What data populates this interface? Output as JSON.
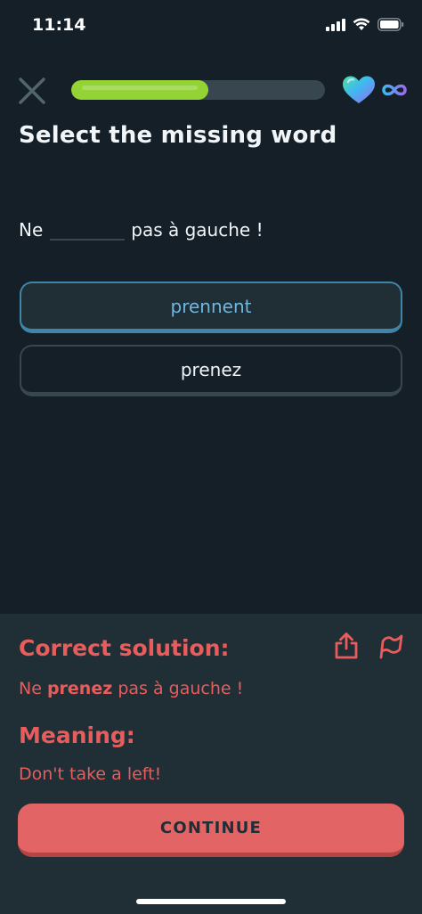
{
  "status_bar": {
    "time": "11:14",
    "icons": [
      "cellular-signal-icon",
      "wifi-icon",
      "battery-icon"
    ]
  },
  "header": {
    "close_icon": "close-icon",
    "progress": 0.54,
    "hearts_icon": "heart-icon",
    "hearts_count_icon": "infinity-icon"
  },
  "challenge": {
    "title": "Select the missing word",
    "sentence_before": "Ne",
    "sentence_after": "pas à gauche !",
    "options": [
      {
        "label": "prennent",
        "selected": true
      },
      {
        "label": "prenez",
        "selected": false
      }
    ]
  },
  "feedback": {
    "solution_heading": "Correct solution:",
    "solution_before": "Ne ",
    "solution_answer": "prenez",
    "solution_after": " pas à gauche !",
    "meaning_heading": "Meaning:",
    "meaning_text": "Don't take a left!",
    "share_icon": "share-icon",
    "report_icon": "flag-icon",
    "continue_label": "CONTINUE"
  },
  "colors": {
    "background": "#141F27",
    "panel": "#202F36",
    "progress_green": "#93D333",
    "selected_blue": "#3F85A7",
    "error_red": "#E85C5C",
    "continue_red": "#E26464"
  }
}
